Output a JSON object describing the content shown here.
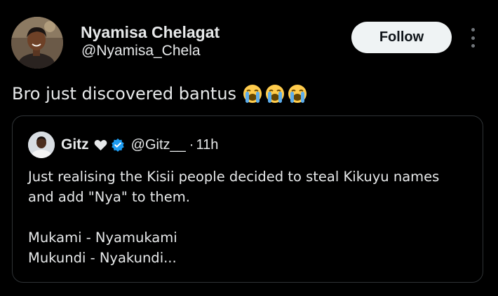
{
  "author": {
    "display_name": "Nyamisa Chelagat",
    "handle": "@Nyamisa_Chela"
  },
  "actions": {
    "follow_label": "Follow",
    "more_icon": "more-vertical-icon"
  },
  "tweet": {
    "text": "Bro just discovered bantus",
    "emojis": [
      "loudly-crying-face",
      "loudly-crying-face",
      "loudly-crying-face"
    ]
  },
  "quoted_tweet": {
    "author_name": "Gitz",
    "badge_icons": [
      "blue-heart-icon",
      "verified-badge-icon"
    ],
    "handle": "@Gitz__",
    "separator": "·",
    "time": "11h",
    "lines": [
      "Just realising the Kisii people decided to steal Kikuyu names",
      "and add \"Nya\" to them.",
      "",
      "Mukami - Nyamukami",
      "Mukundi - Nyakundi..."
    ]
  },
  "colors": {
    "background": "#000000",
    "text": "#e7e9ea",
    "follow_bg": "#eff3f4",
    "border": "#2f3336",
    "verified_blue": "#1d9bf0"
  }
}
